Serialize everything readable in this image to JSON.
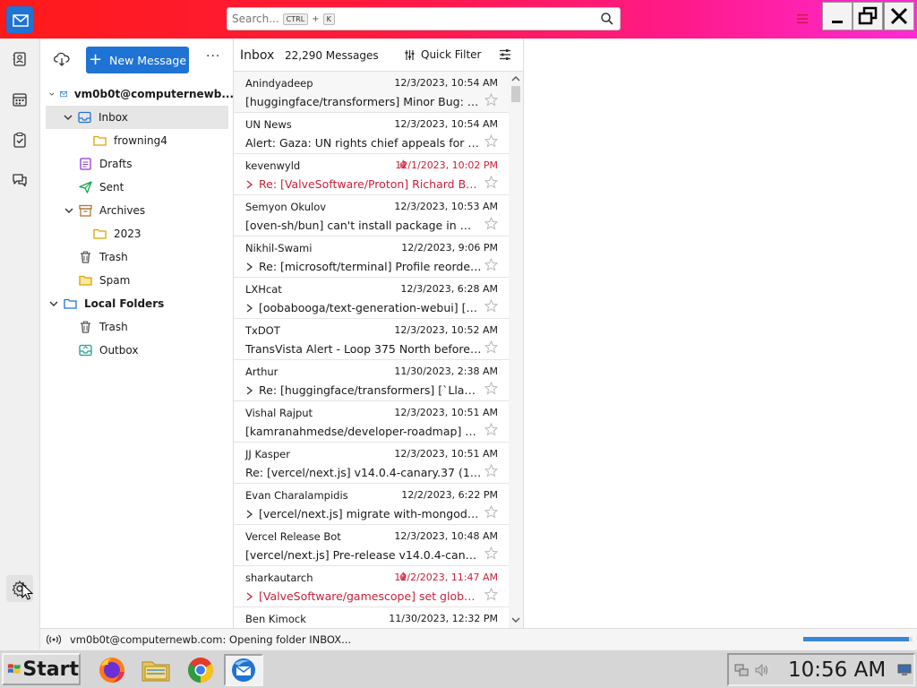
{
  "search": {
    "placeholder": "Search...",
    "key1": "CTRL",
    "plus": "+",
    "key2": "K"
  },
  "toolbar": {
    "new_message": "New Message"
  },
  "folders": {
    "account": "vm0b0t@computernewb.com",
    "account_display": "vm0b0t@computernewb...",
    "items": [
      {
        "label": "Inbox"
      },
      {
        "label": "frowning4"
      },
      {
        "label": "Drafts"
      },
      {
        "label": "Sent"
      },
      {
        "label": "Archives"
      },
      {
        "label": "2023"
      },
      {
        "label": "Trash"
      },
      {
        "label": "Spam"
      }
    ],
    "local": {
      "label": "Local Folders",
      "items": [
        {
          "label": "Trash"
        },
        {
          "label": "Outbox"
        }
      ]
    }
  },
  "list": {
    "title": "Inbox",
    "count": "22,290 Messages",
    "quick_filter": "Quick Filter"
  },
  "messages": [
    {
      "sender": "Anindyadeep",
      "date": "12/3/2023, 10:54 AM",
      "subject": "[huggingface/transformers] Minor Bug: Bo...",
      "thread": false,
      "hot": false
    },
    {
      "sender": "UN News",
      "date": "12/3/2023, 10:54 AM",
      "subject": "Alert: Gaza: UN rights chief appeals for en...",
      "thread": false,
      "hot": false
    },
    {
      "sender": "kevenwyld",
      "date": "12/1/2023, 10:02 PM",
      "subject": "Re: [ValveSoftware/Proton] Richard Burns ...",
      "thread": true,
      "hot": true
    },
    {
      "sender": "Semyon Okulov",
      "date": "12/3/2023, 10:53 AM",
      "subject": "[oven-sh/bun] can't install package in mon...",
      "thread": false,
      "hot": false
    },
    {
      "sender": "Nikhil-Swami",
      "date": "12/2/2023, 9:06 PM",
      "subject": "Re: [microsoft/terminal] Profile reorderi...",
      "thread": true,
      "hot": false
    },
    {
      "sender": "LXHcat",
      "date": "12/3/2023, 6:28 AM",
      "subject": "[oobabooga/text-generation-webui] [Bu...",
      "thread": true,
      "hot": false
    },
    {
      "sender": "TxDOT",
      "date": "12/3/2023, 10:52 AM",
      "subject": "TransVista Alert - Loop 375 North before S...",
      "thread": false,
      "hot": false
    },
    {
      "sender": "Arthur",
      "date": "11/30/2023, 2:38 AM",
      "subject": "Re: [huggingface/transformers] [`Llava`] ...",
      "thread": true,
      "hot": false
    },
    {
      "sender": "Vishal Rajput",
      "date": "12/3/2023, 10:51 AM",
      "subject": "[kamranahmedse/developer-roadmap] Ad...",
      "thread": false,
      "hot": false
    },
    {
      "sender": "JJ Kasper",
      "date": "12/3/2023, 10:51 AM",
      "subject": "Re: [vercel/next.js] v14.0.4-canary.37 (141d...",
      "thread": false,
      "hot": false
    },
    {
      "sender": "Evan Charalampidis",
      "date": "12/2/2023, 6:22 PM",
      "subject": "[vercel/next.js] migrate with-mongodb-...",
      "thread": true,
      "hot": false
    },
    {
      "sender": "Vercel Release Bot",
      "date": "12/3/2023, 10:48 AM",
      "subject": "[vercel/next.js] Pre-release v14.0.4-canary.3...",
      "thread": false,
      "hot": false
    },
    {
      "sender": "sharkautarch",
      "date": "12/2/2023, 11:47 AM",
      "subject": "[ValveSoftware/gamescope] set global def...",
      "thread": true,
      "hot": true
    },
    {
      "sender": "Ben Kimock",
      "date": "11/30/2023, 12:32 PM",
      "subject": "",
      "thread": false,
      "hot": false
    }
  ],
  "status": {
    "text": "vm0b0t@computernewb.com: Opening folder INBOX...",
    "progress": 0.97
  },
  "taskbar": {
    "start": "Start",
    "clock": "10:56 AM"
  },
  "colors": {
    "accent": "#1f73d4",
    "hot": "#c9213a"
  }
}
